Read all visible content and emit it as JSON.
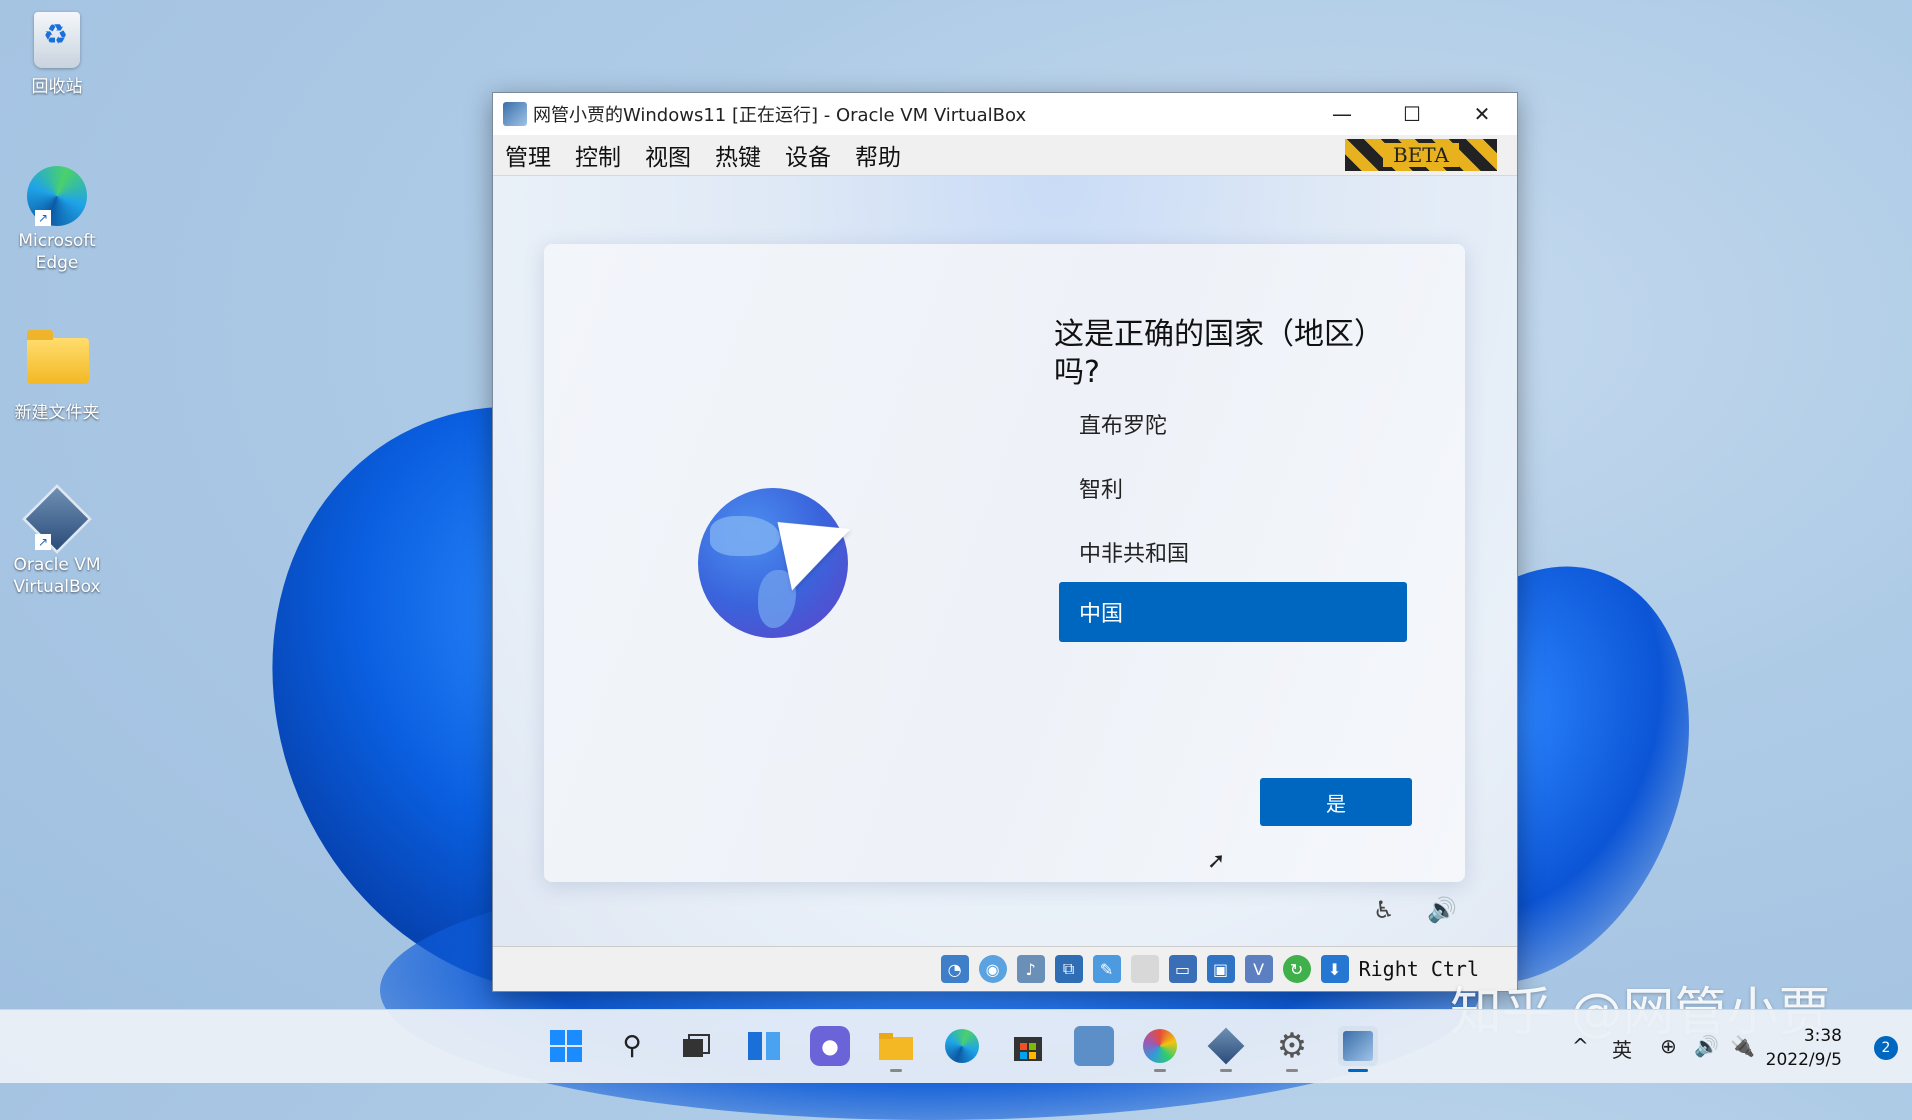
{
  "desktop": {
    "icons": [
      {
        "label": "回收站",
        "icon": "recycle-bin-icon"
      },
      {
        "label": "Microsoft Edge",
        "icon": "edge-icon"
      },
      {
        "label": "新建文件夹",
        "icon": "folder-icon"
      },
      {
        "label": "Oracle VM VirtualBox",
        "icon": "virtualbox-icon"
      }
    ]
  },
  "window": {
    "title": "网管小贾的Windows11 [正在运行] - Oracle VM VirtualBox",
    "minimize_glyph": "—",
    "maximize_glyph": "☐",
    "close_glyph": "✕",
    "menu": [
      "管理",
      "控制",
      "视图",
      "热键",
      "设备",
      "帮助"
    ],
    "beta_label": "BETA"
  },
  "oobe": {
    "question": "这是正确的国家（地区）吗?",
    "countries": [
      "直布罗陀",
      "智利",
      "中非共和国",
      "中国"
    ],
    "selected_country": "中国",
    "yes_button": "是",
    "accessibility_glyph": "♿",
    "volume_glyph": "🔊"
  },
  "statusbar": {
    "icons": [
      "hard-disk-icon",
      "optical-drive-icon",
      "audio-icon",
      "network-icon",
      "usb-icon",
      "shared-folder-icon",
      "display-icon",
      "recording-icon",
      "virtualization-icon",
      "mouse-integration-icon",
      "download-icon"
    ],
    "host_key": "Right Ctrl"
  },
  "taskbar": {
    "apps": [
      "start-icon",
      "search-icon",
      "task-view-icon",
      "widgets-icon",
      "chat-icon",
      "file-explorer-icon",
      "edge-icon",
      "store-icon",
      "control-panel-icon",
      "paint-icon",
      "virtualbox-icon",
      "settings-icon",
      "vm-window-icon"
    ],
    "tray": {
      "chevron": "^",
      "ime": "英",
      "network_glyph": "⊕",
      "volume_glyph": "🔊",
      "power_glyph": "🔌"
    },
    "time": "3:38",
    "date": "2022/9/5",
    "notification_count": "2"
  },
  "watermark": "知乎 @网管小贾",
  "colors": {
    "accent": "#0067c0",
    "window_border": "#7a8a9c"
  }
}
